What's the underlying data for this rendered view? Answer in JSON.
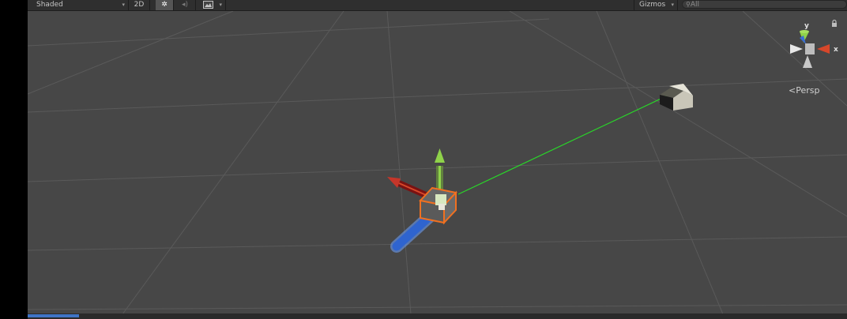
{
  "toolbar": {
    "shading_mode": "Shaded",
    "mode_2d": "2D",
    "lighting_icon": "sun-icon",
    "audio_icon": "speaker-icon",
    "effects_icon": "image-effects-icon",
    "gizmos": "Gizmos",
    "search_placeholder": "All"
  },
  "scene": {
    "projection_label": "Persp",
    "axes": {
      "x": "x",
      "y": "y",
      "z": ""
    },
    "colors": {
      "background": "#474747",
      "grid": "#5a5a5a",
      "x_axis": "#d6472a",
      "y_axis": "#8fd24a",
      "z_axis": "#3a6fd6",
      "selection": "#f07020",
      "ray": "#29d629"
    }
  }
}
